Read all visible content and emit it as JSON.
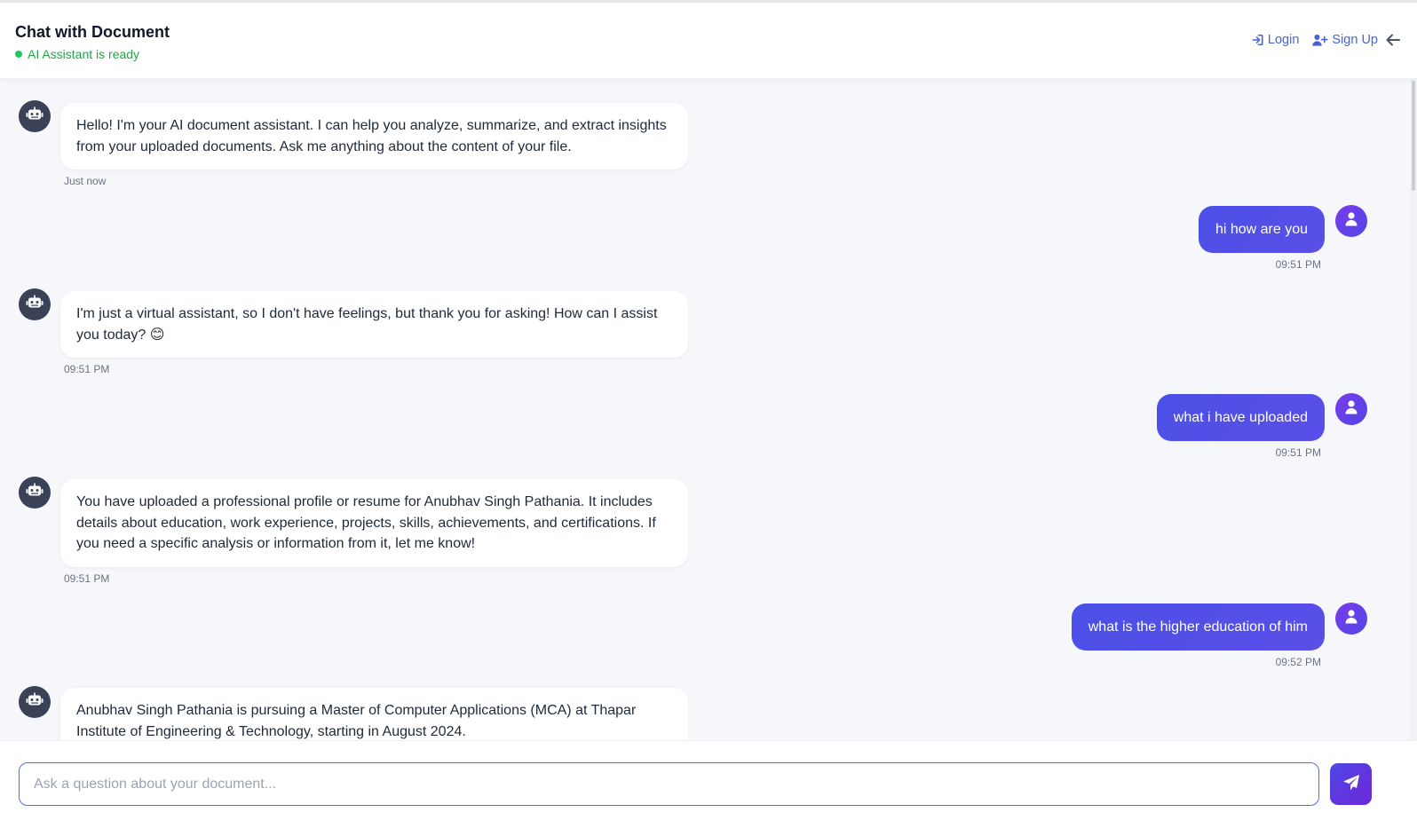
{
  "header": {
    "title": "Chat with Document",
    "status": "AI Assistant is ready",
    "login_label": "Login",
    "signup_label": "Sign Up"
  },
  "messages": [
    {
      "role": "bot",
      "text": "Hello! I'm your AI document assistant. I can help you analyze, summarize, and extract insights from your uploaded documents. Ask me anything about the content of your file.",
      "time": "Just now"
    },
    {
      "role": "user",
      "text": "hi how are you",
      "time": "09:51 PM"
    },
    {
      "role": "bot",
      "text": "I'm just a virtual assistant, so I don't have feelings, but thank you for asking! How can I assist you today? 😊",
      "time": "09:51 PM"
    },
    {
      "role": "user",
      "text": "what i have uploaded",
      "time": "09:51 PM"
    },
    {
      "role": "bot",
      "text": "You have uploaded a professional profile or resume for Anubhav Singh Pathania. It includes details about education, work experience, projects, skills, achievements, and certifications. If you need a specific analysis or information from it, let me know!",
      "time": "09:51 PM"
    },
    {
      "role": "user",
      "text": "what is the higher education of him",
      "time": "09:52 PM"
    },
    {
      "role": "bot",
      "text": "Anubhav Singh Pathania is pursuing a Master of Computer Applications (MCA) at Thapar Institute of Engineering & Technology, starting in August 2024.",
      "time": ""
    }
  ],
  "composer": {
    "placeholder": "Ask a question about your document...",
    "value": ""
  },
  "icons": {
    "login": "sign-in-icon",
    "signup": "user-plus-icon",
    "back": "arrow-left-icon",
    "bot_avatar": "robot-icon",
    "user_avatar": "user-icon",
    "send": "paper-plane-icon"
  },
  "colors": {
    "accent": "#4f54e5",
    "status": "#22a447",
    "link": "#4763d8"
  }
}
